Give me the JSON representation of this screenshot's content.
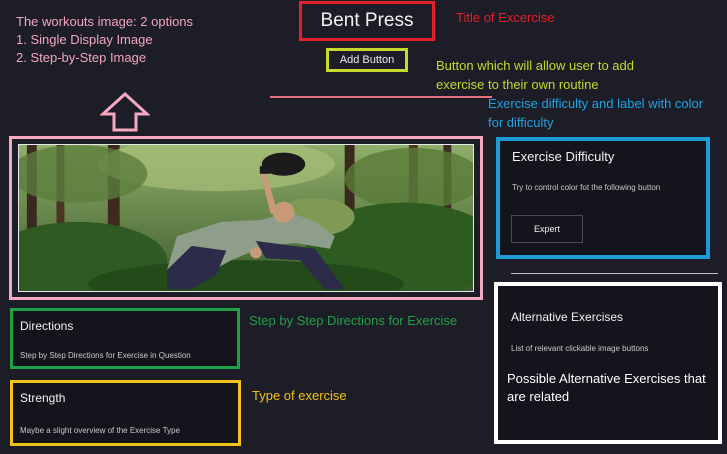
{
  "note": {
    "line1": "The workouts image: 2 options",
    "line2": "1. Single Display Image",
    "line3": "2. Step-by-Step Image"
  },
  "header": {
    "title": "Bent Press",
    "title_annotation": "Title of Excercise",
    "add_button_label": "Add Button",
    "add_button_annotation": "Button which will allow user to add exercise to their own routine",
    "difficulty_annotation": "Exercise difficulty and label with color for difficulty"
  },
  "difficulty": {
    "title": "Exercise Difficulty",
    "help_text": "Try to control color fot the following button",
    "button_label": "Expert"
  },
  "directions": {
    "title": "Directions",
    "subtitle": "Step by Step Directions for Exercise in Question",
    "annotation": "Step by Step Directions for Exercise"
  },
  "strength": {
    "title": "Strength",
    "subtitle": "Maybe a slight overview of the Exercise Type",
    "annotation": "Type of exercise"
  },
  "alternatives": {
    "title": "Alternative Exercises",
    "subtitle": "List of relevant clickable image buttons",
    "note": "Possible Alternative Exercises that are related"
  },
  "colors": {
    "background": "#1d1d28",
    "title_annotation": "#e3202a",
    "add_annotation": "#c6d92c",
    "difficulty_annotation": "#1f9ad8",
    "image_frame": "#f4a9c0",
    "directions_annotation": "#22a046",
    "strength_annotation": "#f2c21a"
  }
}
